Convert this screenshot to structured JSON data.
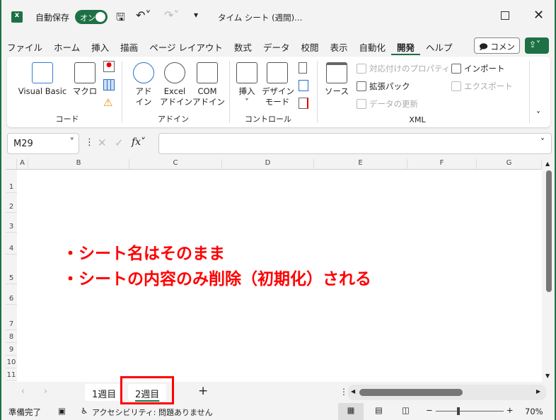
{
  "titlebar": {
    "autosave_label": "自動保存",
    "autosave_state": "オン",
    "doc_title": "タイム シート (週間)…"
  },
  "menu": [
    "ファイル",
    "ホーム",
    "挿入",
    "描画",
    "ページ レイアウト",
    "数式",
    "データ",
    "校閲",
    "表示",
    "自動化",
    "開発",
    "ヘルプ"
  ],
  "menu_active": "開発",
  "comment_button": "コメント",
  "ribbon": {
    "code": {
      "label": "コード",
      "visual_basic": "Visual Basic",
      "macro": "マクロ"
    },
    "addins": {
      "label": "アドイン",
      "addin": "アド\nイン",
      "excel_addin": "Excel\nアドイン",
      "com_addin": "COM\nアドイン"
    },
    "controls": {
      "label": "コントロール",
      "insert": "挿入",
      "design_mode": "デザイン\nモード"
    },
    "xml": {
      "label": "XML",
      "source": "ソース",
      "map_properties": "対応付けのプロパティ",
      "expansion_packs": "拡張パック",
      "refresh_data": "データの更新",
      "import": "インポート",
      "export": "エクスポート"
    }
  },
  "formula": {
    "name_box": "M29",
    "value": ""
  },
  "columns": [
    "A",
    "B",
    "C",
    "D",
    "E",
    "F",
    "G"
  ],
  "rows": [
    "1",
    "2",
    "3",
    "4",
    "5",
    "6",
    "7",
    "8",
    "9",
    "10",
    "11"
  ],
  "notes": [
    "・シート名はそのまま",
    "・シートの内容のみ削除（初期化）される"
  ],
  "sheets": [
    "1週目",
    "2週目"
  ],
  "active_sheet": "2週目",
  "status": {
    "ready": "準備完了",
    "accessibility": "アクセシビリティ: 問題ありません",
    "zoom": "70%"
  },
  "colors": {
    "accent": "#1e7145",
    "highlight": "#ff0000"
  }
}
